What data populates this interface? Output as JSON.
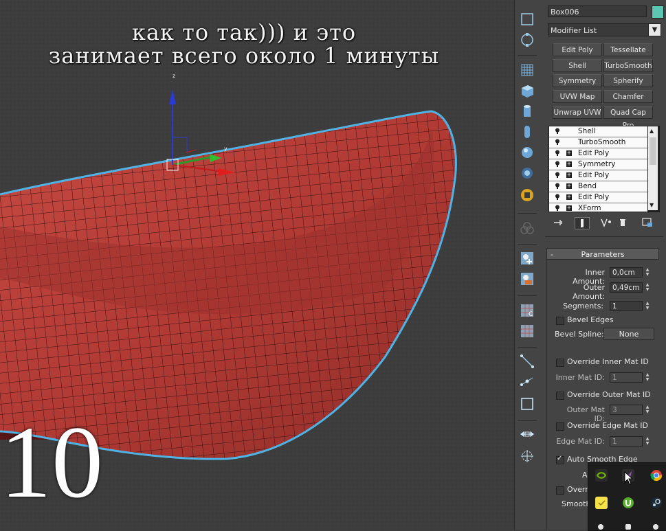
{
  "overlay": {
    "caption_line1": "как то так))) и это",
    "caption_line2": "занимает всего около 1 минуты",
    "big_number": "10"
  },
  "viewport": {
    "gizmo_axis_z": "z",
    "gizmo_axis_y": "y",
    "mesh_color": "#b13a34",
    "selection_outline_color": "#4fb3e6"
  },
  "command_panel": {
    "object_name": "Box006",
    "object_color": "#5dc6b3",
    "modifier_list_label": "Modifier List",
    "modifier_buttons": [
      "Edit Poly",
      "Tessellate",
      "Shell",
      "TurboSmooth",
      "Symmetry",
      "Spherify",
      "UVW Map",
      "Chamfer",
      "Unwrap UVW",
      "Quad Cap Pro"
    ],
    "stack": [
      {
        "label": "Shell",
        "expandable": false
      },
      {
        "label": "TurboSmooth",
        "expandable": false
      },
      {
        "label": "Edit Poly",
        "expandable": true
      },
      {
        "label": "Symmetry",
        "expandable": true
      },
      {
        "label": "Edit Poly",
        "expandable": true
      },
      {
        "label": "Bend",
        "expandable": true
      },
      {
        "label": "Edit Poly",
        "expandable": true
      },
      {
        "label": "XForm",
        "expandable": true
      }
    ]
  },
  "parameters": {
    "title": "Parameters",
    "collapse_symbol": "-",
    "inner_amount_label": "Inner Amount:",
    "inner_amount_value": "0,0cm",
    "outer_amount_label": "Outer Amount:",
    "outer_amount_value": "0,49cm",
    "segments_label": "Segments:",
    "segments_value": "1",
    "bevel_edges_label": "Bevel Edges",
    "bevel_edges_checked": false,
    "bevel_spline_label": "Bevel Spline:",
    "bevel_spline_value": "None",
    "override_inner_label": "Override Inner Mat ID",
    "inner_mat_id_label": "Inner Mat ID:",
    "inner_mat_id_value": "1",
    "override_outer_label": "Override Outer Mat ID",
    "outer_mat_id_label": "Outer Mat ID:",
    "outer_mat_id_value": "3",
    "override_edge_label": "Override Edge Mat ID",
    "edge_mat_id_label": "Edge Mat ID:",
    "edge_mat_id_value": "1",
    "auto_smooth_label": "Auto Smooth Edge",
    "auto_smooth_checked": true,
    "angle_label_partial": "A",
    "override_partial_label": "Overr",
    "smooth_partial_label": "Smooth"
  },
  "taskbar_tray": {
    "icons": [
      "nvidia-icon",
      "feather-icon",
      "chrome-icon",
      "sticky-notes-icon",
      "utorrent-icon",
      "steam-icon"
    ]
  }
}
